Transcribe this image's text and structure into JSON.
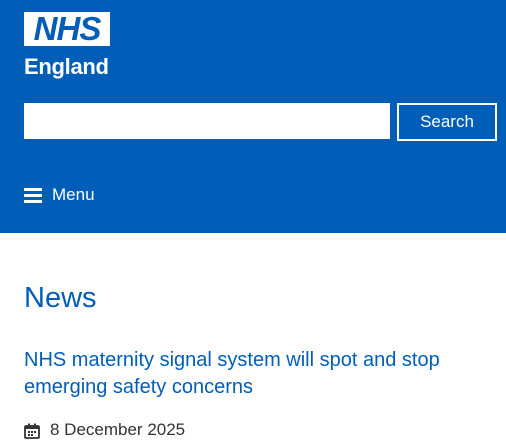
{
  "header": {
    "logo": {
      "mark": "NHS",
      "subtitle": "England"
    },
    "search": {
      "value": "",
      "placeholder": "",
      "button_label": "Search"
    },
    "menu_label": "Menu"
  },
  "main": {
    "page_title": "News",
    "article": {
      "title": "NHS maternity signal system will spot and stop emerging safety concerns",
      "date": "8 December 2025",
      "date_icon": "calendar-icon"
    }
  },
  "colors": {
    "brand_blue": "#005eb8",
    "text_dark": "#333333",
    "white": "#ffffff"
  },
  "icons": {
    "menu": "menu-icon",
    "date": "calendar-icon"
  }
}
